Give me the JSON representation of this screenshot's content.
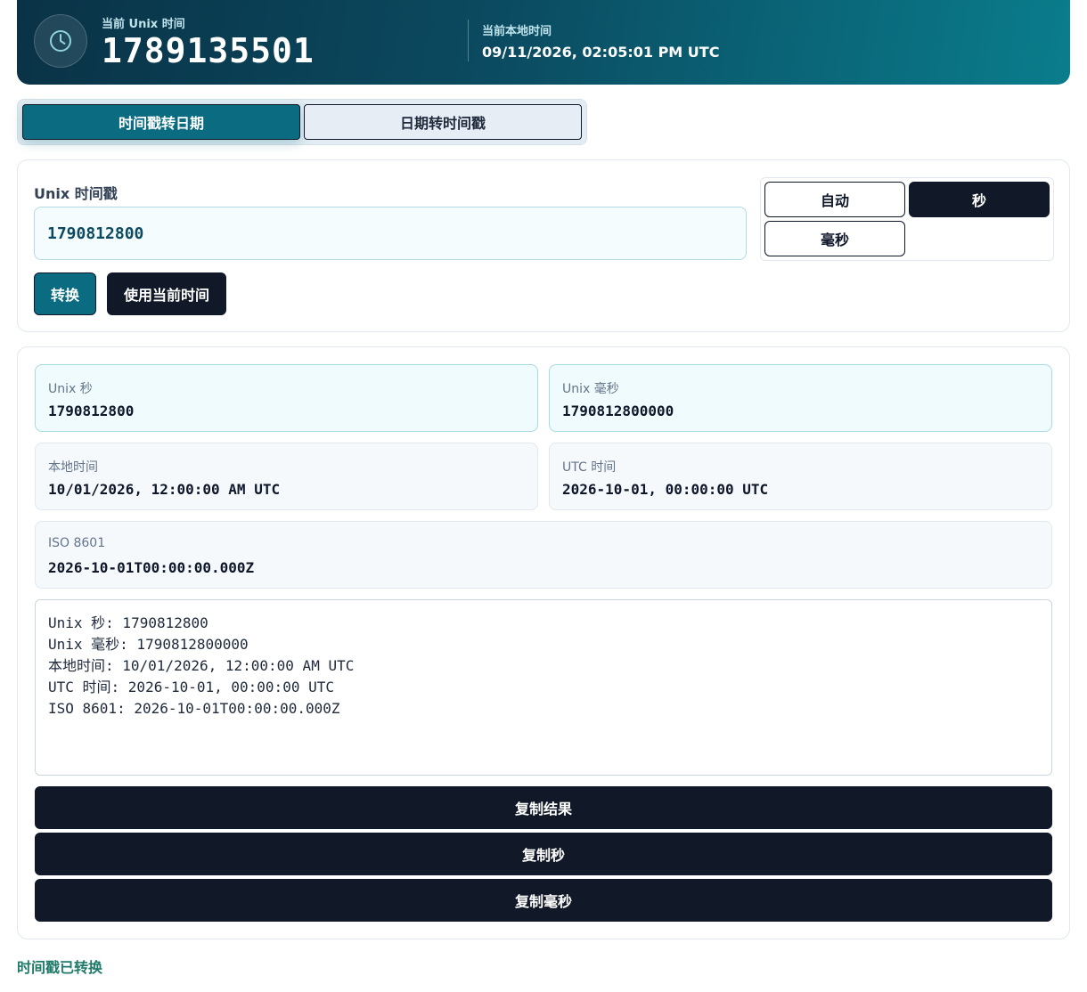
{
  "header": {
    "current_unix_label": "当前 Unix 时间",
    "current_unix_value": "1789135501",
    "local_time_label": "当前本地时间",
    "local_time_value": "09/11/2026, 02:05:01 PM UTC",
    "icon": "clock-icon"
  },
  "tabs": [
    {
      "label": "时间戳转日期",
      "active": true
    },
    {
      "label": "日期转时间戳",
      "active": false
    }
  ],
  "input": {
    "label": "Unix 时间戳",
    "value": "1790812800",
    "units": [
      {
        "label": "自动",
        "selected": false
      },
      {
        "label": "秒",
        "selected": true
      },
      {
        "label": "毫秒",
        "selected": false
      }
    ],
    "convert_label": "转换",
    "use_now_label": "使用当前时间"
  },
  "result": {
    "unix_seconds": {
      "label": "Unix 秒",
      "value": "1790812800"
    },
    "unix_millis": {
      "label": "Unix 毫秒",
      "value": "1790812800000"
    },
    "local_time": {
      "label": "本地时间",
      "value": "10/01/2026, 12:00:00 AM UTC"
    },
    "utc_time": {
      "label": "UTC 时间",
      "value": "2026-10-01, 00:00:00 UTC"
    },
    "iso": {
      "label": "ISO 8601",
      "value": "2026-10-01T00:00:00.000Z"
    },
    "output_lines": [
      "Unix 秒: 1790812800",
      "Unix 毫秒: 1790812800000",
      "本地时间: 10/01/2026, 12:00:00 AM UTC",
      "UTC 时间: 2026-10-01, 00:00:00 UTC",
      "ISO 8601: 2026-10-01T00:00:00.000Z"
    ],
    "copy_result_label": "复制结果",
    "copy_seconds_label": "复制秒",
    "copy_millis_label": "复制毫秒"
  },
  "status": "时间戳已转换",
  "colors": {
    "accent": "#0b6b80",
    "dark": "#111827",
    "status": "#1f7a6a"
  }
}
